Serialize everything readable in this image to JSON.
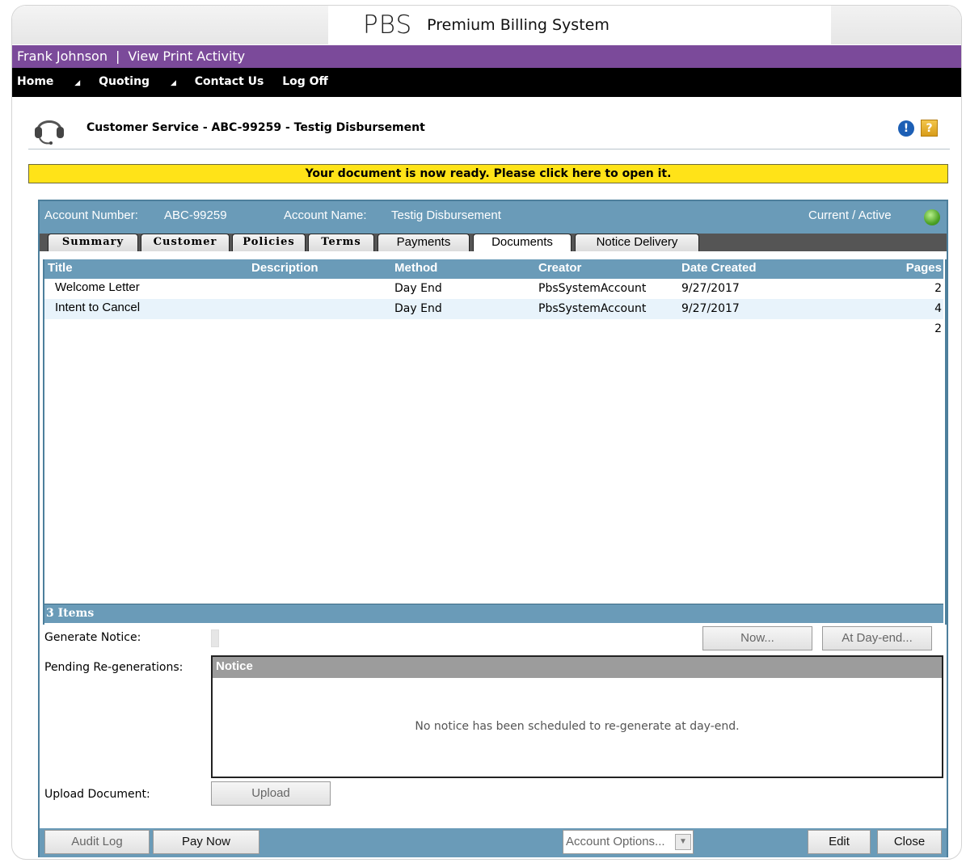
{
  "app": {
    "logo": "PBS",
    "name": "Premium Billing System"
  },
  "user_bar": {
    "user": "Frank Johnson",
    "separator": "|",
    "print_activity": "View Print Activity"
  },
  "nav": {
    "home": "Home",
    "quoting": "Quoting",
    "contact": "Contact Us",
    "logoff": "Log Off",
    "caret": "◢"
  },
  "page": {
    "title": "Customer Service - ABC-99259 - Testig Disbursement",
    "help_icon": "!",
    "question_icon": "?"
  },
  "banner": {
    "text": "Your document is now ready. Please click here to open it."
  },
  "account": {
    "number_label": "Account Number:",
    "number": "ABC-99259",
    "name_label": "Account Name:",
    "name": "Testig Disbursement",
    "status": "Current / Active",
    "status_color": "#4ea326"
  },
  "tabs": [
    "Summary",
    "Customer",
    "Policies",
    "Terms",
    "Payments",
    "Documents",
    "Notice Delivery"
  ],
  "active_tab": "Documents",
  "grid": {
    "columns": [
      "Title",
      "Description",
      "Method",
      "Creator",
      "Date Created",
      "Pages"
    ],
    "rows": [
      {
        "title": "Welcome Letter",
        "description": "",
        "method": "Day End",
        "creator": "PbsSystemAccount",
        "date": "9/27/2017",
        "pages": "2"
      },
      {
        "title": "Intent to Cancel",
        "description": "",
        "method": "Day End",
        "creator": "PbsSystemAccount",
        "date": "9/27/2017",
        "pages": "4"
      },
      {
        "title": "",
        "description": "",
        "method": "",
        "creator": "",
        "date": "",
        "pages": "2"
      }
    ],
    "count": "3 Items"
  },
  "generate": {
    "label": "Generate Notice:",
    "now_button": "Now...",
    "dayend_button": "At Day-end..."
  },
  "pending": {
    "label": "Pending Re-generations:",
    "column": "Notice",
    "empty": "No notice has been scheduled to re-generate at day-end."
  },
  "upload": {
    "label": "Upload Document:",
    "button": "Upload"
  },
  "footer": {
    "audit": "Audit Log",
    "pay": "Pay Now",
    "options": "Account Options...",
    "edit": "Edit",
    "close": "Close"
  }
}
